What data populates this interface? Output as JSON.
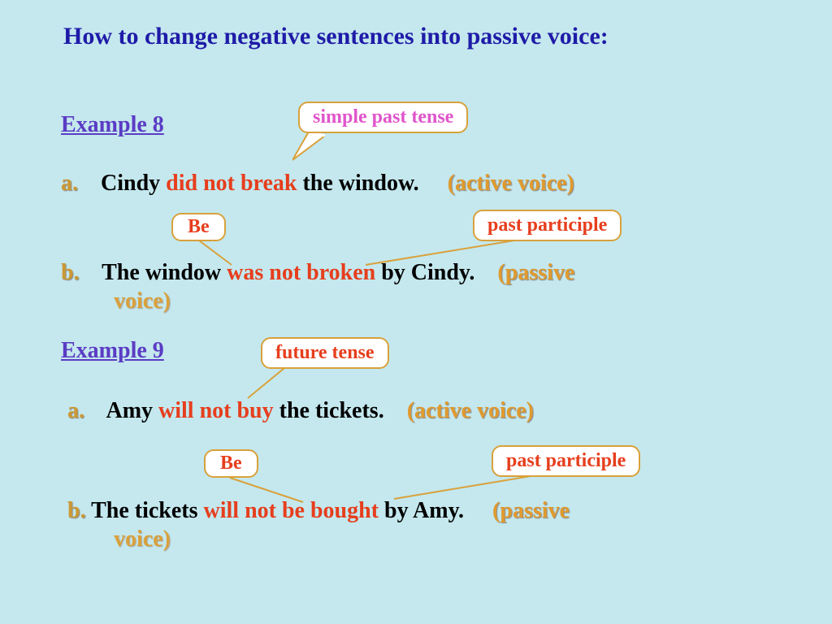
{
  "title": "How to change negative sentences into passive voice:",
  "example8": {
    "heading": "Example 8",
    "tenseLabel": "simple past tense",
    "beLabel": "Be",
    "ppLabel": "past participle",
    "a": {
      "letter": "a.",
      "subject": "Cindy",
      "verb": "did not break",
      "object": "the window.",
      "voice": "(active voice)"
    },
    "b": {
      "letter": "b.",
      "subject": "The window",
      "verb": "was not broken",
      "agent": "by Cindy.",
      "voice": "(passive",
      "voiceCont": "voice)"
    }
  },
  "example9": {
    "heading": "Example 9",
    "tenseLabel": "future tense",
    "beLabel": "Be",
    "ppLabel": "past participle",
    "a": {
      "letter": "a.",
      "subject": "Amy",
      "verb": "will not buy",
      "object": "the tickets.",
      "voice": "(active voice)"
    },
    "b": {
      "letter": "b.",
      "subject": "The tickets",
      "verb": "will not be bought",
      "agent": "by Amy.",
      "voice": "(passive",
      "voiceCont": "voice)"
    }
  }
}
